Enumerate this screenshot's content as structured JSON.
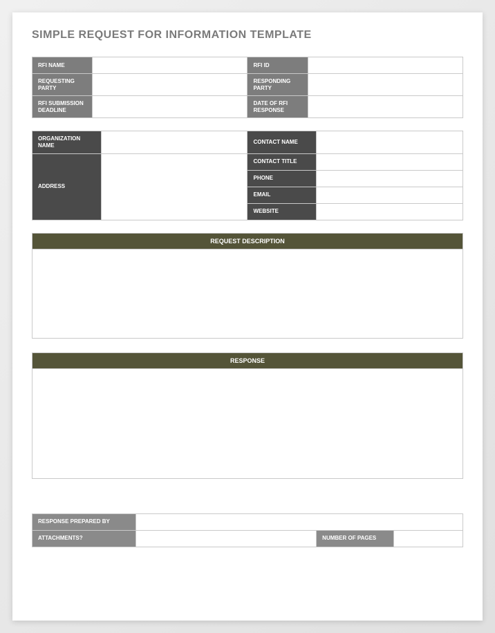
{
  "title": "SIMPLE REQUEST FOR INFORMATION TEMPLATE",
  "table1": {
    "rfi_name_label": "RFI NAME",
    "rfi_name_value": "",
    "rfi_id_label": "RFI ID",
    "rfi_id_value": "",
    "requesting_party_label": "REQUESTING PARTY",
    "requesting_party_value": "",
    "responding_party_label": "RESPONDING PARTY",
    "responding_party_value": "",
    "submission_deadline_label": "RFI SUBMISSION DEADLINE",
    "submission_deadline_value": "",
    "date_response_label": "DATE OF RFI RESPONSE",
    "date_response_value": ""
  },
  "table2": {
    "org_name_label": "ORGANIZATION NAME",
    "org_name_value": "",
    "contact_name_label": "CONTACT NAME",
    "contact_name_value": "",
    "address_label": "ADDRESS",
    "address_value": "",
    "contact_title_label": "CONTACT TITLE",
    "contact_title_value": "",
    "phone_label": "PHONE",
    "phone_value": "",
    "email_label": "EMAIL",
    "email_value": "",
    "website_label": "WEBSITE",
    "website_value": ""
  },
  "sections": {
    "request_desc_label": "REQUEST DESCRIPTION",
    "request_desc_value": "",
    "response_label": "RESPONSE",
    "response_value": ""
  },
  "table3": {
    "prepared_by_label": "RESPONSE PREPARED BY",
    "prepared_by_value": "",
    "attachments_label": "ATTACHMENTS?",
    "attachments_value": "",
    "num_pages_label": "NUMBER OF PAGES",
    "num_pages_value": ""
  }
}
